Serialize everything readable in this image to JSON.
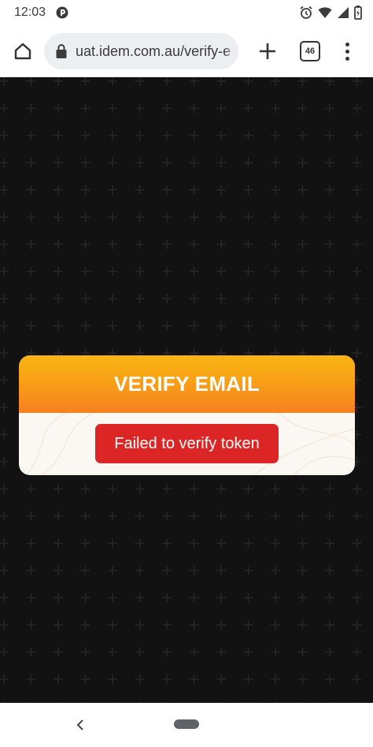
{
  "status_bar": {
    "time": "12:03",
    "icons": [
      "app-notification-icon",
      "alarm-icon",
      "wifi-icon",
      "signal-icon",
      "battery-icon"
    ]
  },
  "browser": {
    "url": "uat.idem.com.au/verify-e",
    "tab_count": "46",
    "icons": [
      "home-icon",
      "lock-icon",
      "plus-icon",
      "tab-switcher-icon",
      "overflow-menu-icon"
    ]
  },
  "card": {
    "title": "VERIFY EMAIL",
    "error_message": "Failed to verify token"
  },
  "colors": {
    "page_background": "#121212",
    "header_gradient_start": "#f9b512",
    "header_gradient_end": "#f58020",
    "error_badge": "#dc2626",
    "card_body": "#fbf7f2"
  },
  "nav_bar": {
    "icons": [
      "back-icon",
      "home-pill"
    ]
  }
}
